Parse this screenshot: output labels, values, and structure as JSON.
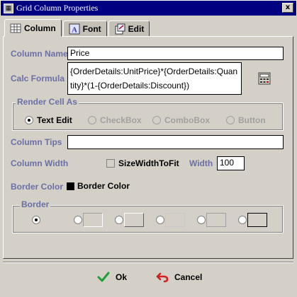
{
  "window": {
    "title": "Grid Column Properties",
    "close_glyph": "x"
  },
  "tabs": [
    {
      "label": "Column",
      "icon": "grid-icon",
      "active": true
    },
    {
      "label": "Font",
      "icon": "font-icon",
      "active": false
    },
    {
      "label": "Edit",
      "icon": "edit-icon",
      "active": false
    }
  ],
  "form": {
    "column_name_label": "Column Name",
    "column_name_value": "Price",
    "calc_formula_label": "Calc Formula",
    "calc_formula_value": "{OrderDetails:UnitPrice}*{OrderDetails:Quantity}*(1-{OrderDetails:Discount})",
    "render_cell_legend": "Render Cell As",
    "render_options": [
      {
        "label": "Text Edit",
        "selected": true,
        "enabled": true
      },
      {
        "label": "CheckBox",
        "selected": false,
        "enabled": false
      },
      {
        "label": "ComboBox",
        "selected": false,
        "enabled": false
      },
      {
        "label": "Button",
        "selected": false,
        "enabled": false
      }
    ],
    "column_tips_label": "Column Tips",
    "column_tips_value": "",
    "column_width_label": "Column Width",
    "size_width_to_fit_label": "SizeWidthToFit",
    "size_width_to_fit_checked": false,
    "width_label": "Width",
    "width_value": "100",
    "border_color_label": "Border Color",
    "border_color_button_label": "Border Color",
    "border_color_value": "#000000",
    "border_legend": "Border",
    "border_options_selected_index": 0
  },
  "footer": {
    "ok_label": "Ok",
    "cancel_label": "Cancel"
  },
  "colors": {
    "title_bar": "#000080",
    "label": "#6b6fa6",
    "background": "#d4d0c8",
    "ok_check": "#1f9e3a",
    "cancel_arrow": "#d02020"
  }
}
